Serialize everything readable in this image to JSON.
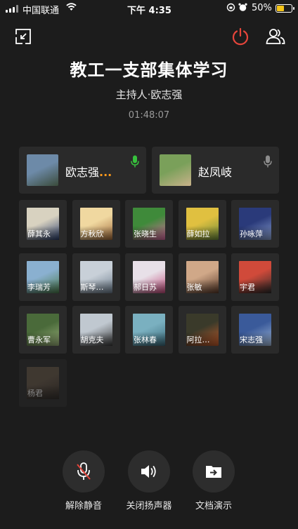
{
  "status_bar": {
    "carrier": "中国联通",
    "time": "下午 4:35",
    "battery": "50%",
    "battery_level": 0.5
  },
  "meeting": {
    "title": "教工一支部集体学习",
    "host": "主持人·欧志强",
    "elapsed": "01:48:07"
  },
  "speakers": [
    {
      "name": "欧志强",
      "dots": "...",
      "mic": "active",
      "avatar": [
        "#6d8aa8",
        "#3a4a3a"
      ]
    },
    {
      "name": "赵凤岐",
      "dots": "",
      "mic": "muted",
      "avatar": [
        "#7aa05a",
        "#c9b28a"
      ]
    }
  ],
  "participants": [
    {
      "name": "薛其永",
      "avatar": [
        "#d8d2c0",
        "#2a3d6a"
      ]
    },
    {
      "name": "方秋欣",
      "avatar": [
        "#f0d8a0",
        "#a06a3a"
      ]
    },
    {
      "name": "张晓生",
      "avatar": [
        "#3f8a3a",
        "#d86aa0"
      ]
    },
    {
      "name": "薛如拉",
      "avatar": [
        "#e0c040",
        "#6a8a3a"
      ]
    },
    {
      "name": "孙咏萍",
      "avatar": [
        "#2a3a7a",
        "#8aa0d0"
      ]
    },
    {
      "name": "李瑞芳",
      "avatar": [
        "#8ab0d0",
        "#4a7a4a"
      ]
    },
    {
      "name": "斯琴…",
      "avatar": [
        "#c8d0d8",
        "#6a7a8a"
      ]
    },
    {
      "name": "郝日苏",
      "avatar": [
        "#e8e0e8",
        "#c04a7a"
      ]
    },
    {
      "name": "张敏",
      "avatar": [
        "#d0a888",
        "#5a3a2a"
      ]
    },
    {
      "name": "宇君",
      "avatar": [
        "#d04a3a",
        "#2a2a2a"
      ]
    },
    {
      "name": "曹永军",
      "avatar": [
        "#4a6a3a",
        "#9ab07a"
      ]
    },
    {
      "name": "胡克夫",
      "avatar": [
        "#c0c8d0",
        "#3a3a3a"
      ]
    },
    {
      "name": "张林春",
      "avatar": [
        "#7ab0c0",
        "#3a6a7a"
      ]
    },
    {
      "name": "阿拉…",
      "avatar": [
        "#3a3a2a",
        "#c05a2a"
      ]
    },
    {
      "name": "宋志强",
      "avatar": [
        "#3a5a9a",
        "#a0b8d8"
      ]
    },
    {
      "name": "杨君",
      "avatar": [
        "#6a5a4a",
        "#3a3028"
      ]
    }
  ],
  "controls": {
    "mute_label": "解除静音",
    "speaker_label": "关闭扬声器",
    "doc_label": "文档演示"
  },
  "colors": {
    "background": "#1c1c1c",
    "card": "#2a2a2a",
    "hangup": "#e5453b",
    "mic_active": "#37c13d",
    "speaking_dots": "#ff9a1a"
  },
  "icons": {
    "minimize": "minimize-icon",
    "hangup": "power-icon",
    "members": "members-icon"
  }
}
